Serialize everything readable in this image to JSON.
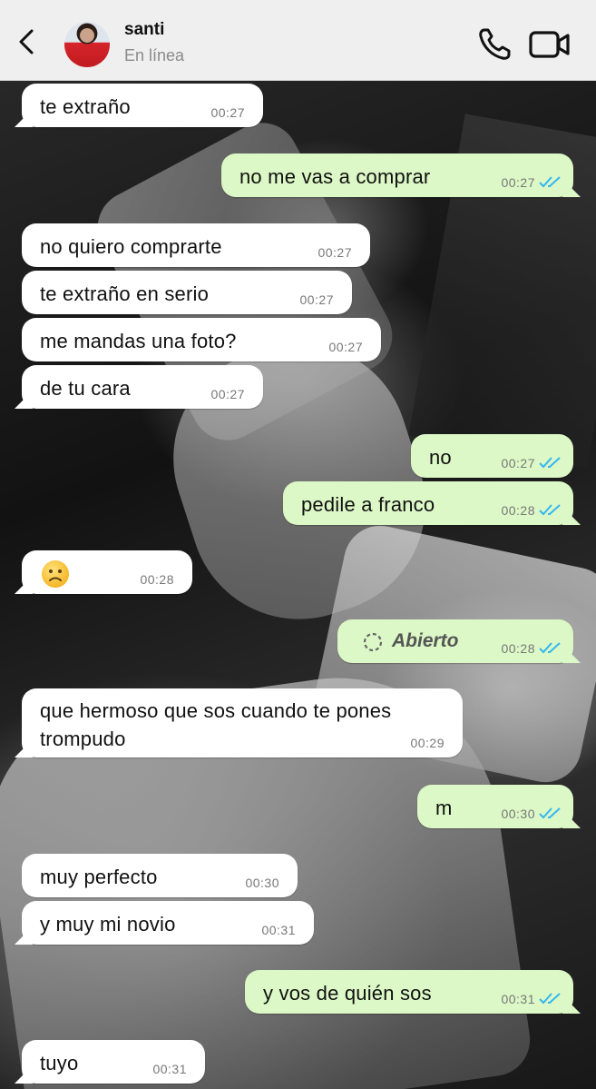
{
  "header": {
    "contact_name": "santi",
    "contact_status": "En línea"
  },
  "messages": [
    {
      "direction": "in",
      "text": "te extraño",
      "time": "00:27"
    },
    {
      "direction": "out",
      "text": "no me vas a comprar",
      "time": "00:27",
      "read": true
    },
    {
      "direction": "in",
      "text": "no quiero comprarte",
      "time": "00:27"
    },
    {
      "direction": "in",
      "text": "te extraño en serio",
      "time": "00:27"
    },
    {
      "direction": "in",
      "text": "me mandas una foto?",
      "time": "00:27"
    },
    {
      "direction": "in",
      "text": "de tu cara",
      "time": "00:27"
    },
    {
      "direction": "out",
      "text": "no",
      "time": "00:27",
      "read": true
    },
    {
      "direction": "out",
      "text": "pedile a franco",
      "time": "00:28",
      "read": true
    },
    {
      "direction": "in",
      "text": "🙁",
      "time": "00:28",
      "emoji": "slightly-frowning-face"
    },
    {
      "direction": "out",
      "text": "Abierto",
      "time": "00:28",
      "read": true,
      "type": "view-once-opened"
    },
    {
      "direction": "in",
      "text": "que hermoso que sos cuando te pones trompudo",
      "time": "00:29"
    },
    {
      "direction": "out",
      "text": "m",
      "time": "00:30",
      "read": true
    },
    {
      "direction": "in",
      "text": "muy perfecto",
      "time": "00:30"
    },
    {
      "direction": "in",
      "text": "y muy mi novio",
      "time": "00:31"
    },
    {
      "direction": "out",
      "text": "y vos de quién sos",
      "time": "00:31",
      "read": true
    },
    {
      "direction": "in",
      "text": "tuyo",
      "time": "00:31"
    }
  ],
  "colors": {
    "incoming_bubble": "#ffffff",
    "outgoing_bubble": "#dcf8c6",
    "read_ticks": "#34b7f1",
    "header_bg": "#f6f6f6"
  },
  "icons": [
    "chevron-left-icon",
    "phone-icon",
    "video-camera-icon",
    "double-check-icon",
    "view-once-icon"
  ]
}
